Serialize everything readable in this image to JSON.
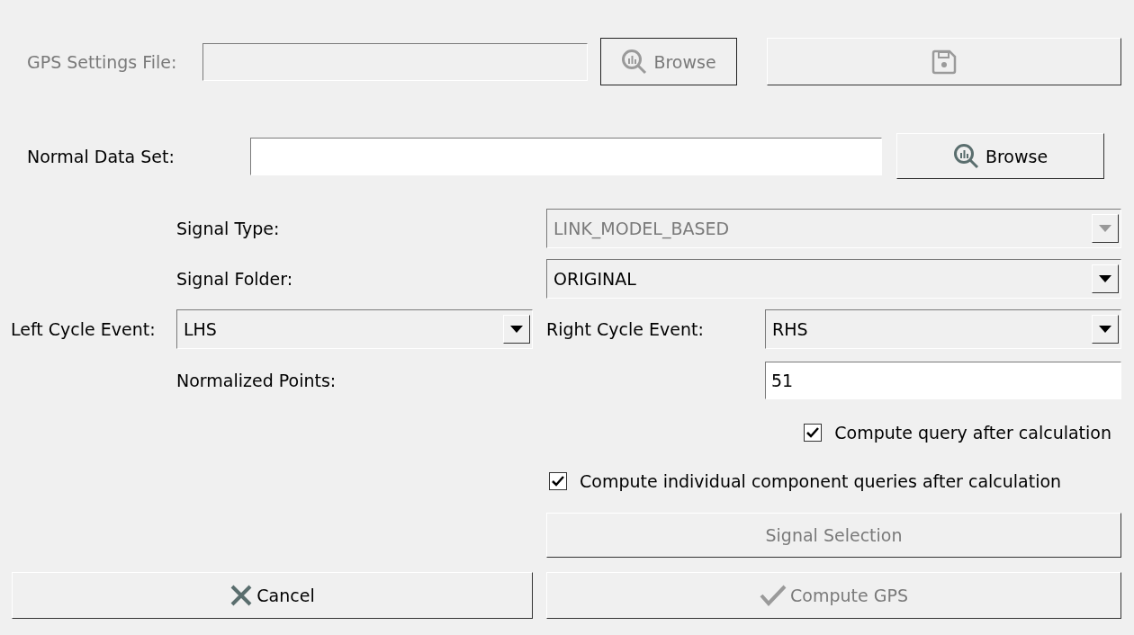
{
  "gps_settings_file": {
    "label": "GPS Settings File:",
    "disabled": true,
    "browse_button": {
      "label": "Browse",
      "disabled": true
    },
    "save_button": {
      "disabled": true
    }
  },
  "normal_data_set": {
    "label": "Normal Data Set:",
    "disabled": false,
    "browse_button": {
      "label": "Browse",
      "disabled": false
    }
  },
  "signal_type": {
    "label": "Signal Type:",
    "value": "LINK_MODEL_BASED",
    "disabled": true
  },
  "signal_folder": {
    "label": "Signal Folder:",
    "value": "ORIGINAL",
    "disabled": false
  },
  "left_cycle_event": {
    "label": "Left Cycle Event:",
    "value": "LHS",
    "disabled": false
  },
  "right_cycle_event": {
    "label": "Right Cycle Event:",
    "value": "RHS",
    "disabled": false
  },
  "normalized_points": {
    "label": "Normalized Points:",
    "value": "51"
  },
  "checkboxes": [
    {
      "label": "Compute query after calculation",
      "checked": true
    },
    {
      "label": "Compute individual component queries after calculation",
      "checked": true
    }
  ],
  "signal_selection_button": {
    "label": "Signal Selection",
    "disabled": true
  },
  "cancel_button": {
    "label": "Cancel",
    "disabled": false
  },
  "compute_button": {
    "label": "Compute GPS",
    "disabled": true
  }
}
